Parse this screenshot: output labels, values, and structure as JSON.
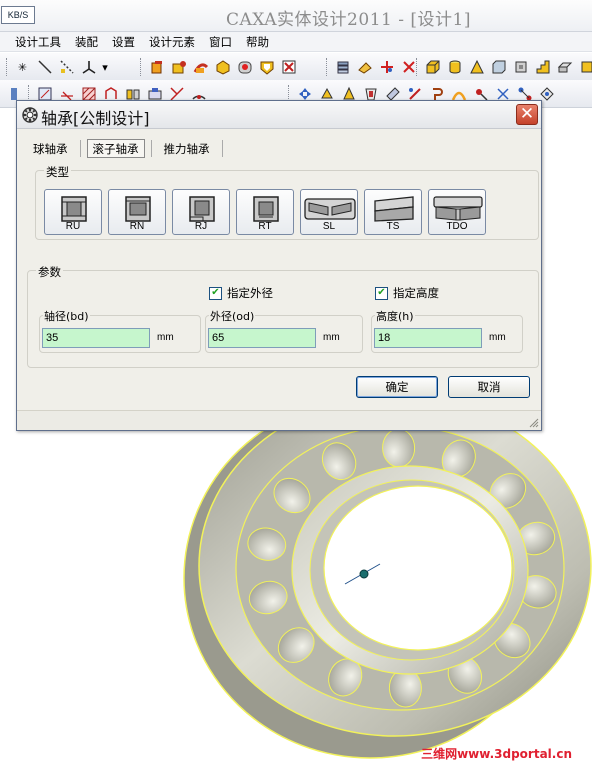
{
  "app": {
    "status_badge": "KB/S",
    "title": "CAXA实体设计2011 - [设计1]"
  },
  "menu": {
    "items": [
      "设计工具",
      "装配",
      "设置",
      "设计元素",
      "窗口",
      "帮助"
    ]
  },
  "dialog": {
    "title": "轴承[公制设计]",
    "close_label": "✕",
    "tabs": [
      {
        "label": "球轴承",
        "active": false
      },
      {
        "label": "滚子轴承",
        "active": true
      },
      {
        "label": "推力轴承",
        "active": false
      }
    ],
    "type_group_label": "类型",
    "types": [
      {
        "label": "RU",
        "icon": "roller-bearing-ru-icon"
      },
      {
        "label": "RN",
        "icon": "roller-bearing-rn-icon"
      },
      {
        "label": "RJ",
        "icon": "roller-bearing-rj-icon"
      },
      {
        "label": "RT",
        "icon": "roller-bearing-rt-icon"
      },
      {
        "label": "SL",
        "icon": "roller-bearing-sl-icon"
      },
      {
        "label": "TS",
        "icon": "roller-bearing-ts-icon"
      },
      {
        "label": "TDO",
        "icon": "roller-bearing-tdo-icon"
      }
    ],
    "params_group_label": "参数",
    "specify_od": {
      "label": "指定外径",
      "checked": true
    },
    "specify_height": {
      "label": "指定高度",
      "checked": true
    },
    "fields": {
      "bore": {
        "label": "轴径(bd)",
        "value": "35",
        "unit": "mm"
      },
      "outer": {
        "label": "外径(od)",
        "value": "65",
        "unit": "mm"
      },
      "height": {
        "label": "高度(h)",
        "value": "18",
        "unit": "mm"
      }
    },
    "ok_label": "确定",
    "cancel_label": "取消"
  },
  "watermark": {
    "brand": "三维网",
    "url": "www.3dportal.cn",
    "color": "#e02030"
  },
  "colors": {
    "input_bg": "#c6f6cd",
    "bearing_edge": "#f2f25a",
    "close_button": "#c4412a"
  }
}
